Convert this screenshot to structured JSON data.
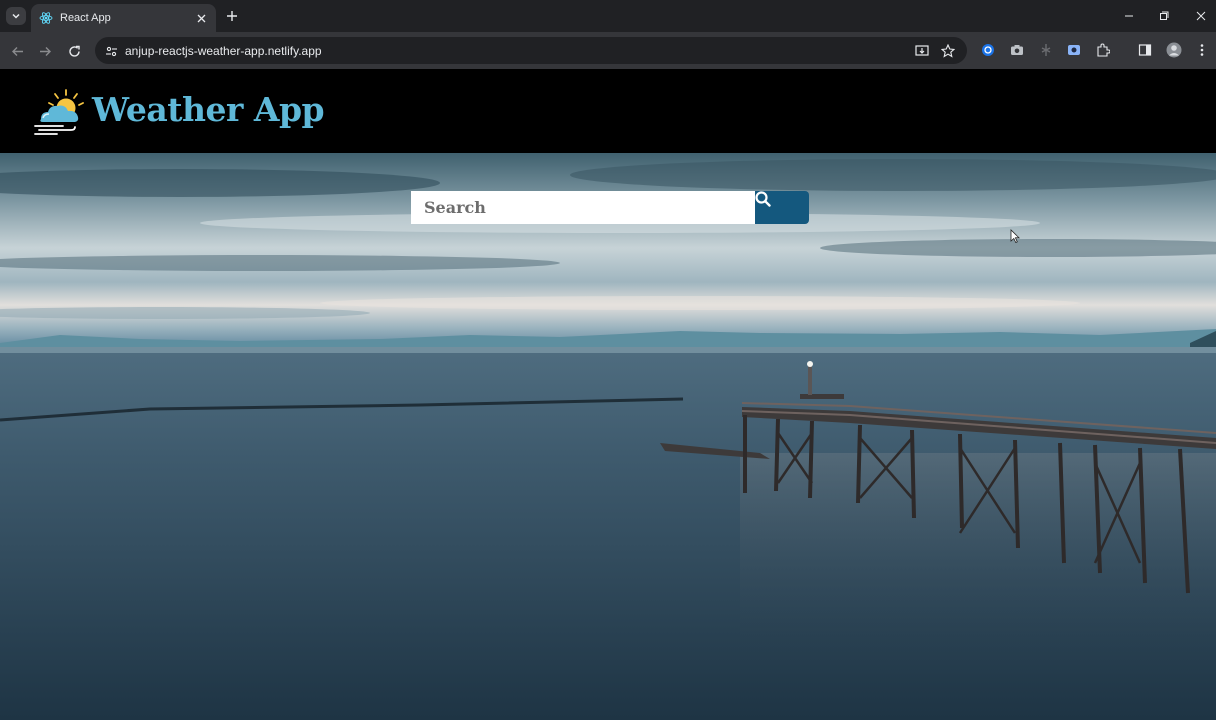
{
  "browser": {
    "tab": {
      "title": "React App",
      "favicon": "react-icon"
    },
    "address": {
      "url": "anjup-reactjs-weather-app.netlify.app"
    }
  },
  "app": {
    "brand": "Weather App",
    "search": {
      "placeholder": "Search"
    }
  },
  "colors": {
    "brand": "#5fb8d8",
    "search_button": "#14587e",
    "header_bg": "#000000"
  }
}
